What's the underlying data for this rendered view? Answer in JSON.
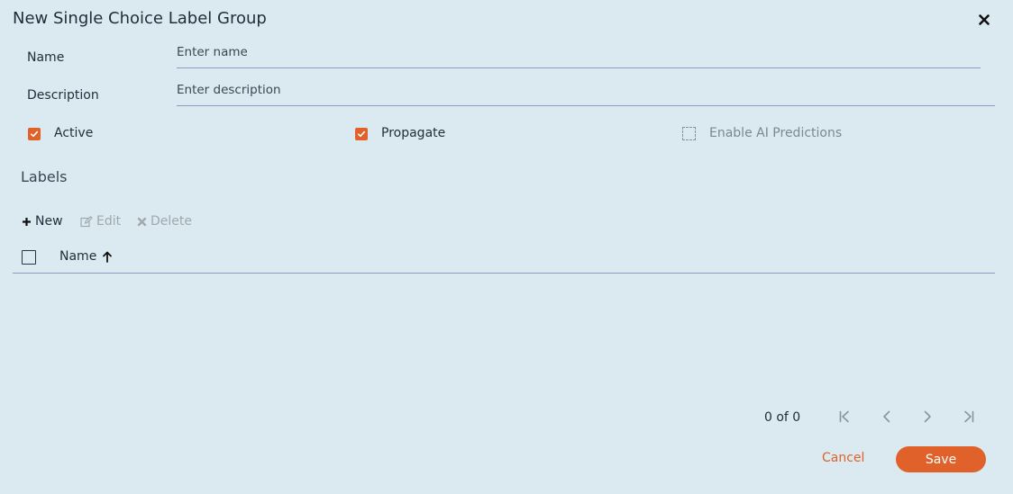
{
  "dialog": {
    "title": "New Single Choice Label Group"
  },
  "form": {
    "name_label": "Name",
    "name_placeholder": "Enter name",
    "name_value": "",
    "description_label": "Description",
    "description_placeholder": "Enter description",
    "description_value": ""
  },
  "options": {
    "active_label": "Active",
    "active_checked": true,
    "propagate_label": "Propagate",
    "propagate_checked": true,
    "ai_label": "Enable AI Predictions",
    "ai_checked": false
  },
  "labels_section": {
    "title": "Labels",
    "toolbar": {
      "new_label": "New",
      "edit_label": "Edit",
      "delete_label": "Delete"
    },
    "table": {
      "columns": [
        "Name"
      ],
      "sort": "ascending",
      "rows": []
    }
  },
  "pager": {
    "text": "0 of 0"
  },
  "footer": {
    "cancel_label": "Cancel",
    "save_label": "Save"
  },
  "colors": {
    "accent": "#e0622a",
    "background": "#dbeaf0",
    "divider": "#8e9bc5"
  }
}
